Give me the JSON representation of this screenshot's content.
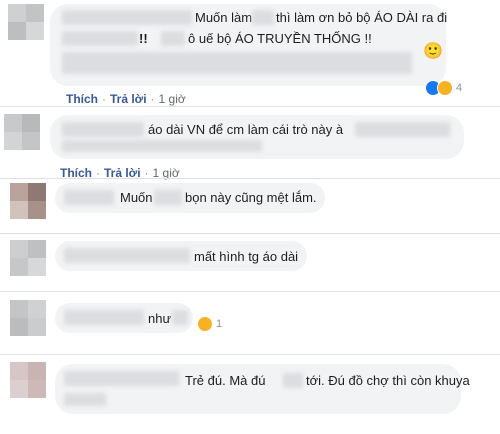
{
  "actions": {
    "like": "Thích",
    "reply": "Trả lời",
    "sep": "·",
    "time": "1 giờ"
  },
  "comments": [
    {
      "line1": "Muốn làm",
      "line1b": "thì làm ơn bỏ bộ ÁO DÀI ra đi",
      "line2a": "!!",
      "line2b": "ô uế bộ ÁO TRUYỀN THỐNG !!",
      "emoji": "🙂",
      "reactions": "4"
    },
    {
      "line1a": "áo dài VN để cm làm cái trò này à"
    },
    {
      "line1a": "Muốn",
      "line1b": "bọn này cũng mệt lắm."
    },
    {
      "line1a": "mất hình tg áo dài"
    },
    {
      "line1a": "như",
      "reactions": "1"
    },
    {
      "line1a": "Trẻ đú. Mà đú",
      "line1b": "tới. Đú đồ chợ thì còn khuya"
    }
  ],
  "colors": {
    "link": "#385898",
    "bubble": "#f2f3f5",
    "text": "#1c1e21",
    "meta": "#616770"
  }
}
